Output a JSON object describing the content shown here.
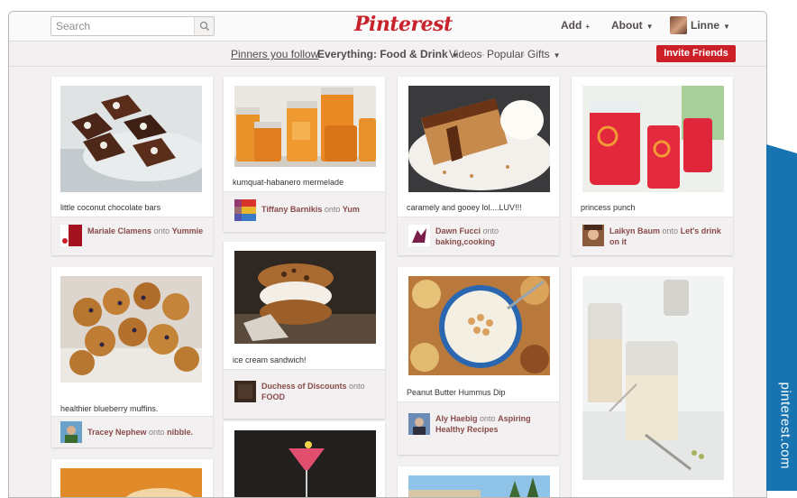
{
  "header": {
    "search_placeholder": "Search",
    "logo": "Pinterest",
    "add_label": "Add",
    "about_label": "About",
    "user_name": "Linne"
  },
  "subnav": {
    "pinners_you_follow": "Pinners you follow",
    "everything": "Everything: Food & Drink",
    "videos": "Videos",
    "popular": "Popular",
    "gifts": "Gifts",
    "invite": "Invite Friends"
  },
  "pins": [
    {
      "caption": "little coconut chocolate bars",
      "pinner": "Mariale Clamens",
      "onto": "onto",
      "board": "Yummie"
    },
    {
      "caption": "kumquat-habanero mermelade",
      "pinner": "Tiffany Barnikis",
      "onto": "onto",
      "board": "Yum"
    },
    {
      "caption": "caramely and gooey lol....LUV!!!",
      "pinner": "Dawn Fucci",
      "onto": "onto",
      "board": "baking,cooking"
    },
    {
      "caption": "princess punch",
      "pinner": "Laikyn Baum",
      "onto": "onto",
      "board": "Let's drink on it"
    },
    {
      "caption": "healthier blueberry muffins.",
      "pinner": "Tracey Nephew",
      "onto": "onto",
      "board": "nibble."
    },
    {
      "caption": "ice cream sandwich!",
      "pinner": "Duchess of Discounts",
      "onto": "onto",
      "board": "FOOD"
    },
    {
      "caption": "Peanut Butter Hummus Dip",
      "pinner": "Aly Haebig",
      "onto": "onto",
      "board": "Aspiring Healthy Recipes"
    }
  ],
  "side_tab": {
    "label": "pinterest.com",
    "color": "#1774b0"
  },
  "colors": {
    "brand_red": "#cb2027",
    "logo_red": "#c8232c"
  }
}
